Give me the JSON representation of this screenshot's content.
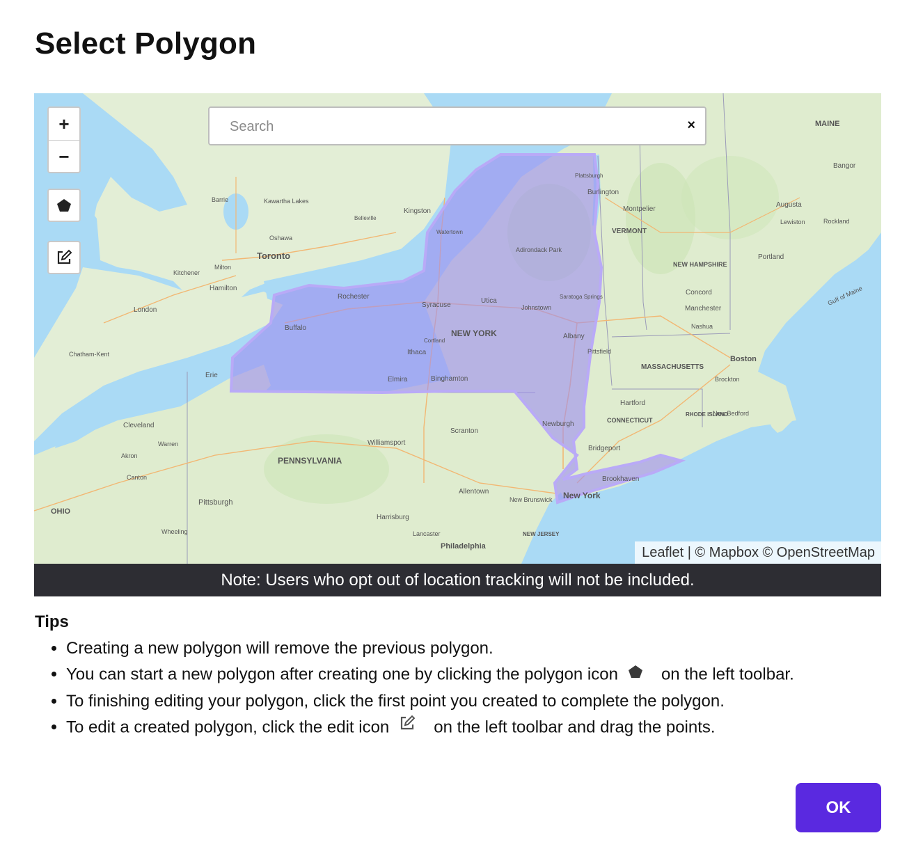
{
  "dialog": {
    "title": "Select Polygon"
  },
  "map": {
    "zoom_in": "+",
    "zoom_out": "−",
    "search_placeholder": "Search",
    "search_clear": "×",
    "attribution": "Leaflet | © Mapbox © OpenStreetMap",
    "tools": {
      "polygon_icon": "polygon-icon",
      "edit_icon": "edit-icon"
    },
    "polygon_fill": "#9c8ef0",
    "labels": {
      "new_york": "NEW YORK",
      "pennsylvania": "PENNSYLVANIA",
      "vermont": "VERMONT",
      "new_hampshire": "NEW HAMPSHIRE",
      "massachusetts": "MASSACHUSETTS",
      "connecticut": "CONNECTICUT",
      "maine": "MAINE",
      "ohio": "OHIO",
      "new_jersey": "NEW JERSEY",
      "rhode_island": "RHODE ISLAND",
      "toronto": "Toronto",
      "buffalo": "Buffalo",
      "rochester": "Rochester",
      "syracuse": "Syracuse",
      "utica": "Utica",
      "albany": "Albany",
      "ithaca": "Ithaca",
      "binghamton": "Binghamton",
      "elmira": "Elmira",
      "boston": "Boston",
      "new_york_city": "New York",
      "philadelphia": "Philadelphia",
      "pittsburgh": "Pittsburgh",
      "erie": "Erie",
      "cleveland": "Cleveland",
      "hartford": "Hartford",
      "newburgh": "Newburgh",
      "scranton": "Scranton",
      "allentown": "Allentown",
      "harrisburg": "Harrisburg",
      "brookhaven": "Brookhaven",
      "bridgeport": "Bridgeport",
      "kingston": "Kingston",
      "hamilton": "Hamilton",
      "london": "London",
      "burlington": "Burlington",
      "montpelier": "Montpelier",
      "concord": "Concord",
      "manchester": "Manchester",
      "portland": "Portland",
      "augusta": "Augusta",
      "bangor": "Bangor",
      "adirondack_park": "Adirondack Park",
      "saratoga": "Saratoga Springs",
      "johnstown": "Johnstown",
      "watertown": "Watertown",
      "plattsburgh": "Plattsburgh",
      "pittsfield": "Pittsfield",
      "cortland": "Cortland",
      "williamsport": "Williamsport",
      "akron": "Akron",
      "canton": "Canton",
      "warren": "Warren",
      "barrie": "Barrie",
      "oshawa": "Oshawa",
      "kawartha_lakes": "Kawartha Lakes",
      "belleville": "Belleville",
      "kitchener": "Kitchener",
      "milton": "Milton",
      "new_brunswick": "New Brunswick",
      "lancaster": "Lancaster",
      "new_bedford": "New Bedford",
      "brockton": "Brockton",
      "nashua": "Nashua",
      "lewiston": "Lewiston",
      "rockland": "Rockland",
      "gulf_of_maine": "Gulf of Maine",
      "wheeling": "Wheeling",
      "chatham_kent": "Chatham-Kent"
    }
  },
  "note": "Note: Users who opt out of location tracking will not be included.",
  "tips": {
    "heading": "Tips",
    "items": [
      "Creating a new polygon will remove the previous polygon.",
      "You can start a new polygon after creating one by clicking the polygon icon",
      "on the left toolbar.",
      "To finishing editing your polygon, click the first point you created to complete the polygon.",
      "To edit a created polygon, click the edit icon",
      "on the left toolbar and drag the points."
    ]
  },
  "buttons": {
    "ok": "OK"
  },
  "colors": {
    "accent": "#5a29e0",
    "note_bg": "#2d2d33",
    "water": "#aadaf5",
    "land": "#dfeccf"
  }
}
